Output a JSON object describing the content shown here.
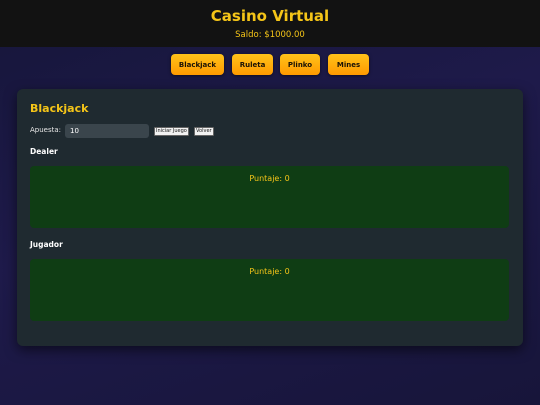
{
  "header": {
    "title": "Casino Virtual",
    "balance": "Saldo: $1000.00"
  },
  "nav": {
    "items": [
      "Blackjack",
      "Ruleta",
      "Plinko",
      "Mines"
    ]
  },
  "game": {
    "title": "Blackjack",
    "bet_label": "Apuesta:",
    "bet_value": "10",
    "start_label": "Iniciar Juego",
    "back_label": "Volver",
    "dealer": {
      "label": "Dealer",
      "score": "Puntaje: 0"
    },
    "player": {
      "label": "Jugador",
      "score": "Puntaje: 0"
    }
  },
  "colors": {
    "accent": "#f5c518",
    "button_gradient_top": "#ffc21a",
    "button_gradient_bottom": "#ff9a00",
    "table_felt": "#0f3d14",
    "card_bg": "#1f2a30"
  }
}
